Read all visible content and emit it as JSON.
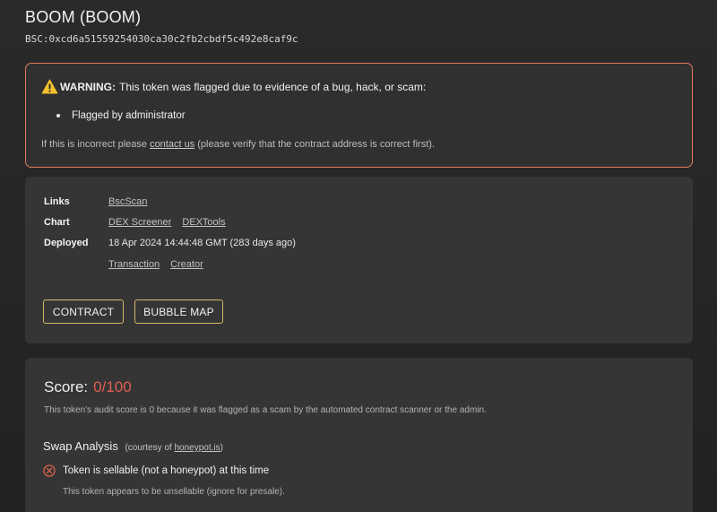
{
  "header": {
    "title": "BOOM (BOOM)",
    "address": "BSC:0xcd6a51559254030ca30c2fb2cbdf5c492e8caf9c"
  },
  "warning": {
    "label": "WARNING:",
    "text": "This token was flagged due to evidence of a bug, hack, or scam:",
    "reasons": [
      "Flagged by administrator"
    ],
    "incorrect_prefix": "If this is incorrect please ",
    "contact_link": "contact us",
    "incorrect_suffix": " (please verify that the contract address is correct first).",
    "border_color": "#e07a5a",
    "icon": "warning-triangle-icon"
  },
  "info": {
    "links_label": "Links",
    "links": [
      "BscScan"
    ],
    "chart_label": "Chart",
    "chart_links": [
      "DEX Screener",
      "DEXTools"
    ],
    "deployed_label": "Deployed",
    "deployed_value": "18 Apr 2024 14:44:48 GMT (283 days ago)",
    "deployed_links": [
      "Transaction",
      "Creator"
    ],
    "buttons": {
      "contract": "CONTRACT",
      "bubble_map": "BUBBLE MAP"
    },
    "button_border_color": "#d8b867"
  },
  "score": {
    "label": "Score:",
    "value": "0/100",
    "value_color": "#e0604f",
    "description": "This token's audit score is 0 because it was flagged as a scam by the automated contract scanner or the admin.",
    "swap_title": "Swap Analysis",
    "swap_courtesy_prefix": "(courtesy of ",
    "swap_courtesy_link": "honeypot.is",
    "swap_courtesy_suffix": ")",
    "check_title": "Token is sellable (not a honeypot) at this time",
    "check_sub": "This token appears to be unsellable (ignore for presale).",
    "check_icon": "x-circle-icon"
  }
}
